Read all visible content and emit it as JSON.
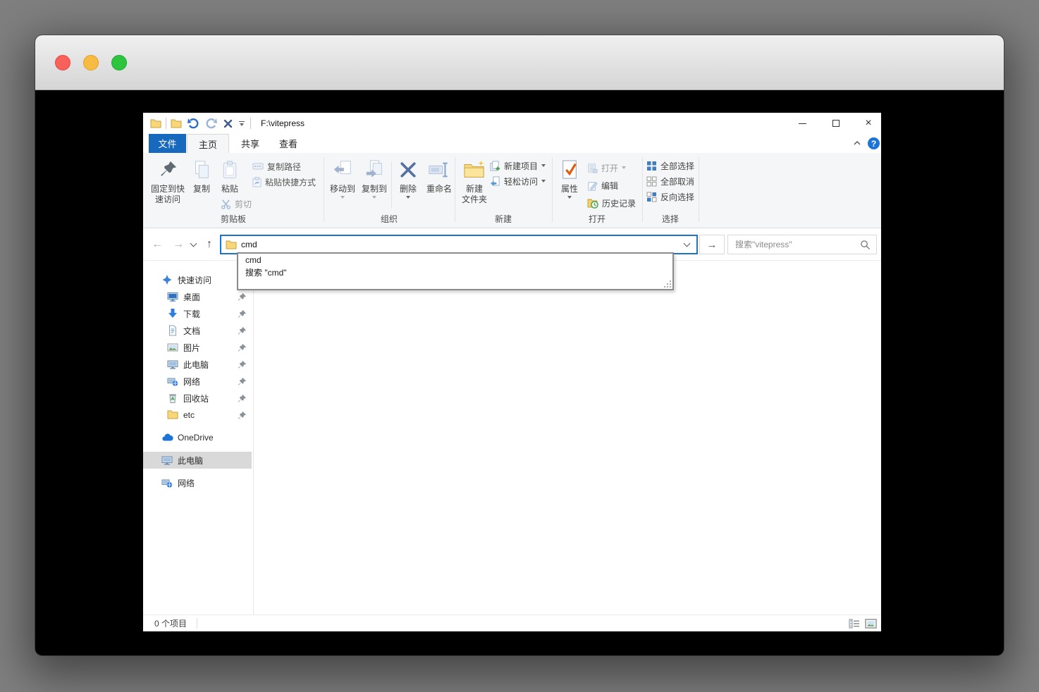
{
  "qat": {
    "path": "F:\\vitepress"
  },
  "window_controls": {
    "close_glyph": "×"
  },
  "tabs": {
    "file": "文件",
    "home": "主页",
    "share": "共享",
    "view": "查看",
    "help": "?"
  },
  "ribbon": {
    "pin_line1": "固定到快",
    "pin_line2": "速访问",
    "copy": "复制",
    "paste": "粘贴",
    "cut": "剪切",
    "copy_path": "复制路径",
    "paste_shortcut": "粘贴快捷方式",
    "move_to": "移动到",
    "copy_to": "复制到",
    "delete": "删除",
    "rename": "重命名",
    "new_folder_line1": "新建",
    "new_folder_line2": "文件夹",
    "new_item": "新建项目",
    "easy_access": "轻松访问",
    "properties": "属性",
    "open": "打开",
    "edit": "编辑",
    "history": "历史记录",
    "select_all": "全部选择",
    "select_none": "全部取消",
    "invert_selection": "反向选择",
    "group_clipboard": "剪贴板",
    "group_organize": "组织",
    "group_new": "新建",
    "group_open": "打开",
    "group_select": "选择"
  },
  "nav": {
    "back": "←",
    "forward": "→",
    "up": "↑",
    "go": "→",
    "address_value": "cmd",
    "search_placeholder": "搜索\"vitepress\""
  },
  "dropdown": {
    "item1": "cmd",
    "item2": "搜索 \"cmd\""
  },
  "sidebar": {
    "quick_access": "快速访问",
    "desktop": "桌面",
    "downloads": "下载",
    "documents": "文档",
    "pictures": "图片",
    "this_pc_quick": "此电脑",
    "network_quick": "网络",
    "recycle_bin": "回收站",
    "etc": "etc",
    "onedrive": "OneDrive",
    "this_pc": "此电脑",
    "network": "网络"
  },
  "status": {
    "item_count": "0 个项目"
  },
  "colors": {
    "accent_blue": "#1669bd",
    "selection_gray": "#d9d9d9",
    "navy_icon": "#54719f"
  }
}
